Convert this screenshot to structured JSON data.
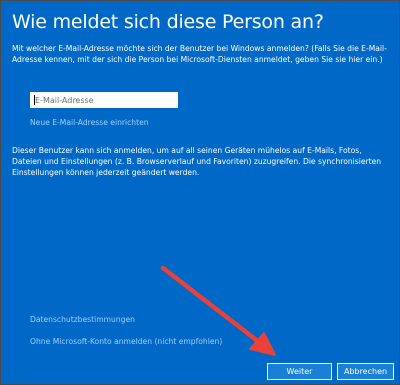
{
  "dialog": {
    "title": "Wie meldet sich diese Person an?",
    "description": "Mit welcher E-Mail-Adresse möchte sich der Benutzer bei Windows anmelden? (Falls Sie die E-Mail-Adresse kennen, mit der sich die Person bei Microsoft-Diensten anmeldet, geben Sie sie hier ein.)",
    "email_placeholder": "E-Mail-Adresse",
    "email_value": "",
    "new_email_link": "Neue E-Mail-Adresse einrichten",
    "info_text": "Dieser Benutzer kann sich anmelden, um auf all seinen Geräten mühelos auf E-Mails, Fotos, Dateien und Einstellungen (z. B. Browserverlauf und Favoriten) zuzugreifen. Die synchronisierten Einstellungen können jederzeit geändert werden.",
    "privacy_link": "Datenschutzbestimmungen",
    "no_account_link": "Ohne Microsoft-Konto anmelden (nicht empfohlen)"
  },
  "buttons": {
    "next_label": "Weiter",
    "cancel_label": "Abbrechen"
  },
  "colors": {
    "dialog_background": "#0068c7",
    "link": "#9fd0ff",
    "button_background": "#1a7fd6",
    "annotation_arrow": "#e8423b"
  }
}
